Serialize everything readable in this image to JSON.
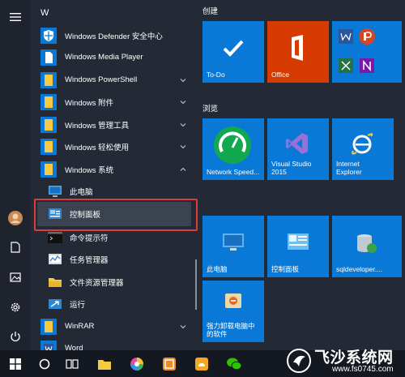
{
  "start_menu": {
    "letter_header": "W",
    "apps": [
      {
        "label": "Windows Defender 安全中心"
      },
      {
        "label": "Windows Media Player"
      },
      {
        "label": "Windows PowerShell"
      },
      {
        "label": "Windows 附件"
      },
      {
        "label": "Windows 管理工具"
      },
      {
        "label": "Windows 轻松使用"
      },
      {
        "label": "Windows 系统"
      }
    ],
    "system_items": [
      {
        "label": "此电脑"
      },
      {
        "label": "控制面板"
      },
      {
        "label": "命令提示符"
      },
      {
        "label": "任务管理器"
      },
      {
        "label": "文件资源管理器"
      },
      {
        "label": "运行"
      }
    ],
    "more_apps": [
      {
        "label": "WinRAR"
      },
      {
        "label": "Word"
      }
    ]
  },
  "tiles": {
    "group_create": "创建",
    "group_browse": "浏览",
    "todo": "To-Do",
    "office": "Office",
    "network_speed": "Network Speed...",
    "visual_studio": "Visual Studio\n2015",
    "ie": "Internet\nExplorer",
    "this_pc": "此电脑",
    "control_panel": "控制面板",
    "sqldeveloper": "sqldeveloper....",
    "cleaner": "强力卸载电脑中\n的软件"
  },
  "watermark": {
    "title": "飞沙系统网",
    "url": "www.fs0745.com"
  },
  "colors": {
    "tile_blue": "#0a78d7",
    "office_orange": "#d83b01",
    "highlight_red": "#e03a3a"
  }
}
